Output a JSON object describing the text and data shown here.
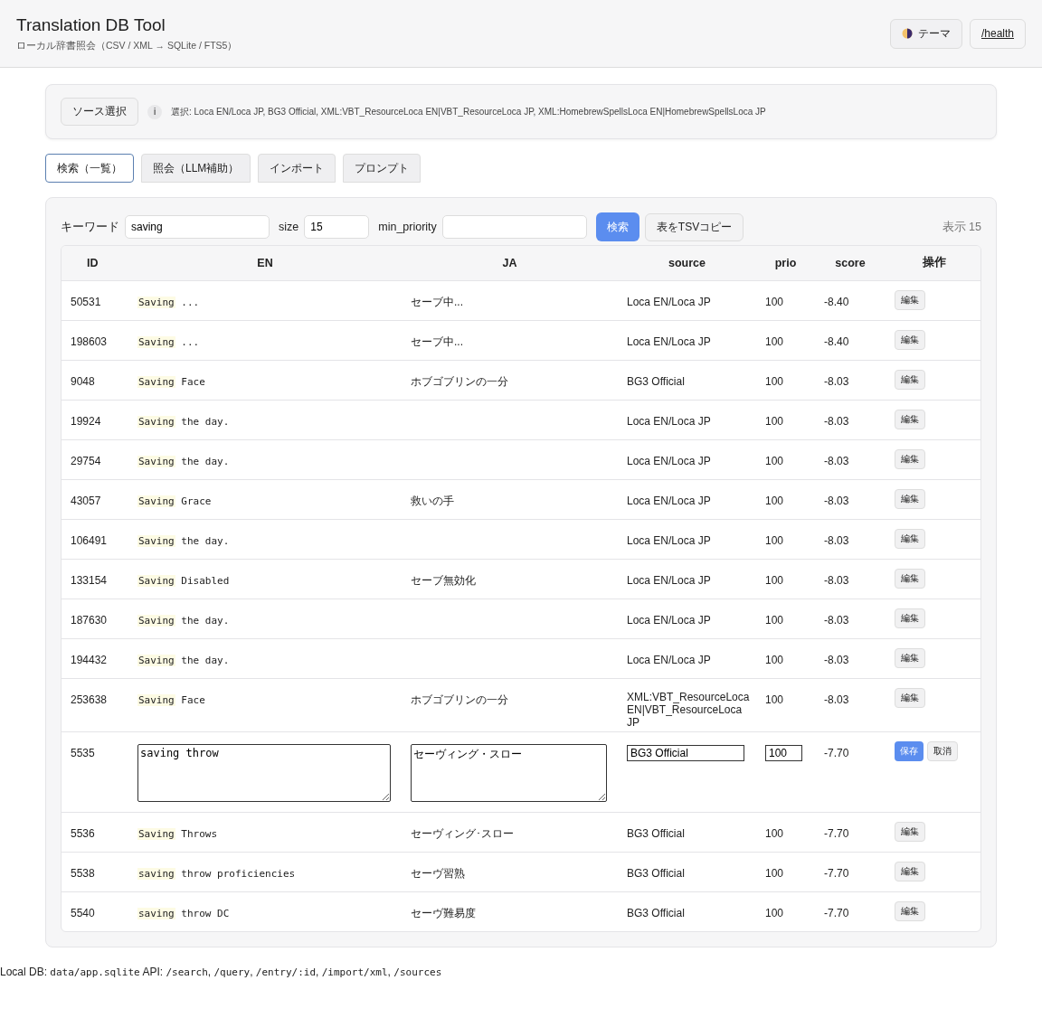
{
  "header": {
    "title": "Translation DB Tool",
    "subtitle": "ローカル辞書照会（CSV / XML → SQLite / FTS5）",
    "theme_button": "テーマ",
    "health_link": "/health"
  },
  "sources": {
    "button": "ソース選択",
    "info": "i",
    "selected_text": "選択: Loca EN/Loca JP, BG3 Official, XML:VBT_ResourceLoca EN|VBT_ResourceLoca JP, XML:HomebrewSpellsLoca EN|HomebrewSpellsLoca JP"
  },
  "tabs": [
    {
      "label": "検索（一覧）",
      "selected": true
    },
    {
      "label": "照会（LLM補助）",
      "selected": false
    },
    {
      "label": "インポート",
      "selected": false
    },
    {
      "label": "プロンプト",
      "selected": false
    }
  ],
  "search": {
    "keyword_label": "キーワード",
    "keyword": "saving",
    "size_label": "size",
    "size": "15",
    "min_priority_label": "min_priority",
    "search_button": "検索",
    "copy_button": "表をTSVコピー",
    "count": "表示 15"
  },
  "table": {
    "columns": [
      "ID",
      "EN",
      "JA",
      "source",
      "prio",
      "score",
      "操作"
    ],
    "rows": [
      {
        "kind": "view",
        "id": "50531",
        "en_match": "Saving",
        "en_rest": "...",
        "ja": "セーブ中...",
        "source": "Loca EN/Loca JP",
        "prio": "100",
        "score": "-8.40",
        "action": "編集"
      },
      {
        "kind": "view",
        "id": "198603",
        "en_match": "Saving",
        "en_rest": "...",
        "ja": "セーブ中...",
        "source": "Loca EN/Loca JP",
        "prio": "100",
        "score": "-8.40",
        "action": "編集"
      },
      {
        "kind": "view",
        "id": "9048",
        "en_match": "Saving",
        "en_rest": "Face",
        "ja": "ホブゴブリンの一分",
        "source": "BG3 Official",
        "prio": "100",
        "score": "-8.03",
        "action": "編集"
      },
      {
        "kind": "view",
        "id": "19924",
        "en_match": "Saving",
        "en_rest": "the day.",
        "source": "Loca EN/Loca JP",
        "prio": "100",
        "score": "-8.03",
        "action": "編集"
      },
      {
        "kind": "view",
        "id": "29754",
        "en_match": "Saving",
        "en_rest": "the day.",
        "source": "Loca EN/Loca JP",
        "prio": "100",
        "score": "-8.03",
        "action": "編集"
      },
      {
        "kind": "view",
        "id": "43057",
        "en_match": "Saving",
        "en_rest": "Grace",
        "ja": "救いの手",
        "source": "Loca EN/Loca JP",
        "prio": "100",
        "score": "-8.03",
        "action": "編集"
      },
      {
        "kind": "view",
        "id": "106491",
        "en_match": "Saving",
        "en_rest": "the day.",
        "source": "Loca EN/Loca JP",
        "prio": "100",
        "score": "-8.03",
        "action": "編集"
      },
      {
        "kind": "view",
        "id": "133154",
        "en_match": "Saving",
        "en_rest": "Disabled",
        "ja": "セーブ無効化",
        "source": "Loca EN/Loca JP",
        "prio": "100",
        "score": "-8.03",
        "action": "編集"
      },
      {
        "kind": "view",
        "id": "187630",
        "en_match": "Saving",
        "en_rest": "the day.",
        "source": "Loca EN/Loca JP",
        "prio": "100",
        "score": "-8.03",
        "action": "編集"
      },
      {
        "kind": "view",
        "id": "194432",
        "en_match": "Saving",
        "en_rest": "the day.",
        "source": "Loca EN/Loca JP",
        "prio": "100",
        "score": "-8.03",
        "action": "編集"
      },
      {
        "kind": "view",
        "id": "253638",
        "en_match": "Saving",
        "en_rest": "Face",
        "ja": "ホブゴブリンの一分",
        "source": "XML:VBT_ResourceLoca EN|VBT_ResourceLoca JP",
        "prio": "100",
        "score": "-8.03",
        "action": "編集"
      },
      {
        "kind": "edit",
        "id": "5535",
        "en": "saving throw",
        "ja": "セーヴィング・スロー",
        "source": "BG3 Official",
        "prio": "100",
        "score": "-7.70",
        "save": "保存",
        "cancel": "取消"
      },
      {
        "kind": "view",
        "id": "5536",
        "en_match": "Saving",
        "en_rest": "Throws",
        "ja": "セーヴィング･スロー",
        "source": "BG3 Official",
        "prio": "100",
        "score": "-7.70",
        "action": "編集"
      },
      {
        "kind": "view",
        "id": "5538",
        "en_match": "saving",
        "en_rest": "throw proficiencies",
        "ja": "セーヴ習熟",
        "source": "BG3 Official",
        "prio": "100",
        "score": "-7.70",
        "action": "編集"
      },
      {
        "kind": "view",
        "id": "5540",
        "en_match": "saving",
        "en_rest": "throw DC",
        "ja": "セーヴ難易度",
        "source": "BG3 Official",
        "prio": "100",
        "score": "-7.70",
        "action": "編集"
      }
    ]
  },
  "footer": [
    {
      "kind": "text",
      "text": "Local DB: "
    },
    {
      "kind": "code",
      "text": "data/app.sqlite"
    },
    {
      "kind": "text",
      "text": " API: "
    },
    {
      "kind": "code",
      "text": "/search"
    },
    {
      "kind": "text",
      "text": ", "
    },
    {
      "kind": "code",
      "text": "/query"
    },
    {
      "kind": "text",
      "text": ", "
    },
    {
      "kind": "code",
      "text": "/entry/:id"
    },
    {
      "kind": "text",
      "text": ", "
    },
    {
      "kind": "code",
      "text": "/import/xml"
    },
    {
      "kind": "text",
      "text": ", "
    },
    {
      "kind": "code",
      "text": "/sources"
    }
  ]
}
